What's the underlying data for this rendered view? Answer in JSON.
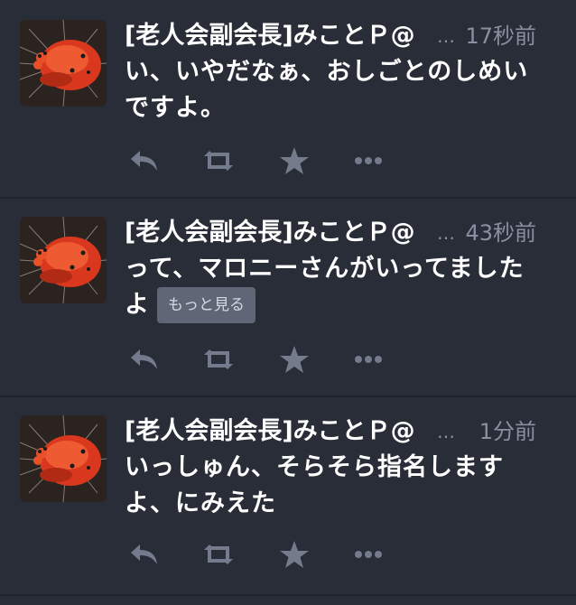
{
  "tweets": [
    {
      "name": "[老人会副会長]みことＰ@",
      "ellipsis": "…",
      "time": "17秒前",
      "text": "い、いやだなぁ、おしごとのしめいですよ。",
      "more": null
    },
    {
      "name": "[老人会副会長]みことＰ@",
      "ellipsis": "…",
      "time": "43秒前",
      "text": "って、マロニーさんがいってましたよ",
      "more": "もっと見る"
    },
    {
      "name": "[老人会副会長]みことＰ@",
      "ellipsis": "…",
      "time": "1分前",
      "text": "いっしゅん、そらそら指名しますよ、にみえた",
      "more": null
    }
  ],
  "icons": {
    "reply": "reply-icon",
    "retweet": "retweet-icon",
    "favorite": "star-icon",
    "more": "more-dots-icon"
  },
  "colors": {
    "background": "#282d38",
    "text": "#ffffff",
    "muted": "#8a90a0",
    "icon": "#737b8c",
    "more_button": "#5f6777"
  }
}
